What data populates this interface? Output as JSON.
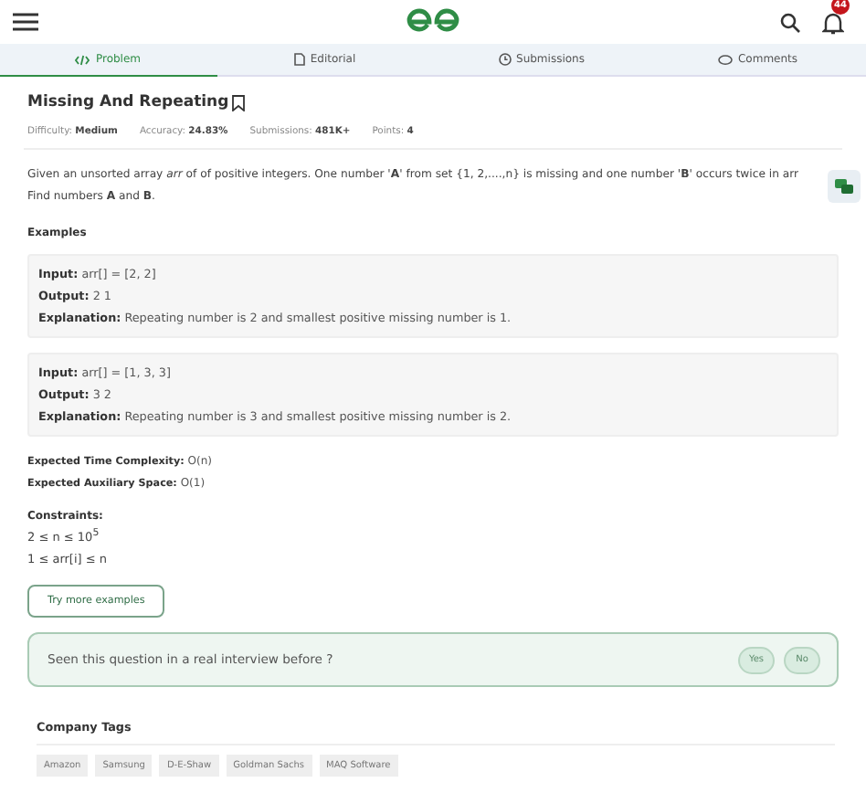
{
  "header": {
    "notification_count": "44"
  },
  "tabs": [
    {
      "label": "Problem",
      "kind": "code",
      "selected": true
    },
    {
      "label": "Editorial",
      "kind": "doc",
      "selected": false
    },
    {
      "label": "Submissions",
      "kind": "clock",
      "selected": false
    },
    {
      "label": "Comments",
      "kind": "chat",
      "selected": false
    }
  ],
  "problem": {
    "title": "Missing And Repeating",
    "meta": [
      {
        "label": "Difficulty:",
        "value": "Medium"
      },
      {
        "label": "Accuracy:",
        "value": "24.83%"
      },
      {
        "label": "Submissions:",
        "value": "481K+"
      },
      {
        "label": "Points:",
        "value": "4"
      }
    ],
    "description": "Given an unsorted array *arr* of of positive integers. One number '**A**' from set {1, 2,....,n} is missing and one number '**B**' occurs twice in arr",
    "description_2": "Find numbers **A** and **B**.",
    "examples_heading": "Examples",
    "examples": [
      {
        "lines": [
          {
            "label": "Input:",
            "value": "arr[] = [2, 2]"
          },
          {
            "label": "Output:",
            "value": "2 1"
          },
          {
            "label": "Explanation:",
            "value": "Repeating number is 2 and smallest positive missing number is 1."
          }
        ]
      },
      {
        "lines": [
          {
            "label": "Input:",
            "value": "arr[] = [1, 3, 3]"
          },
          {
            "label": "Output:",
            "value": "3 2"
          },
          {
            "label": "Explanation:",
            "value": "Repeating number is 3 and smallest positive missing number is 2."
          }
        ]
      }
    ],
    "complexity": [
      {
        "label": "Expected Time Complexity:",
        "value": "O(n)"
      },
      {
        "label": "Expected Auxiliary Space:",
        "value": "O(1)"
      }
    ],
    "constraints_heading": "Constraints:",
    "constraints": [
      "2 ≤ n ≤ 10$^{5}$",
      "1 ≤ arr[i] ≤ n"
    ],
    "more_button": "Try more examples"
  },
  "interview": {
    "question": "Seen this question in a real interview before ?",
    "buttons": [
      "Yes",
      "No"
    ]
  },
  "company_tags": {
    "heading": "Company Tags",
    "tags": [
      "Amazon",
      "Samsung",
      "D-E-Shaw",
      "Goldman Sachs",
      "MAQ Software"
    ]
  }
}
